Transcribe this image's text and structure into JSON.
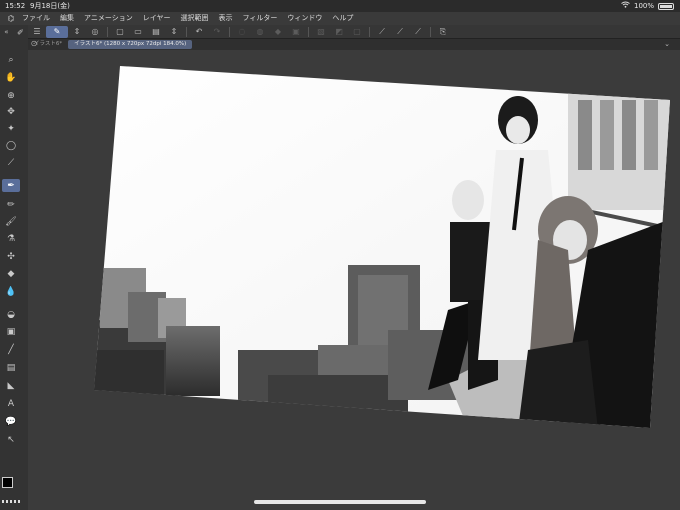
{
  "status_bar": {
    "time": "15:52",
    "date": "9月18日(金)",
    "wifi": "wifi-icon",
    "battery": "100%"
  },
  "menu": {
    "items": [
      "ファイル",
      "編集",
      "アニメーション",
      "レイヤー",
      "選択範囲",
      "表示",
      "フィルター",
      "ウィンドウ",
      "ヘルプ"
    ]
  },
  "tabs": {
    "inactive": "イラスト6*",
    "active": "イラスト6* (1280 x 720px 72dpi 184.0%)"
  }
}
